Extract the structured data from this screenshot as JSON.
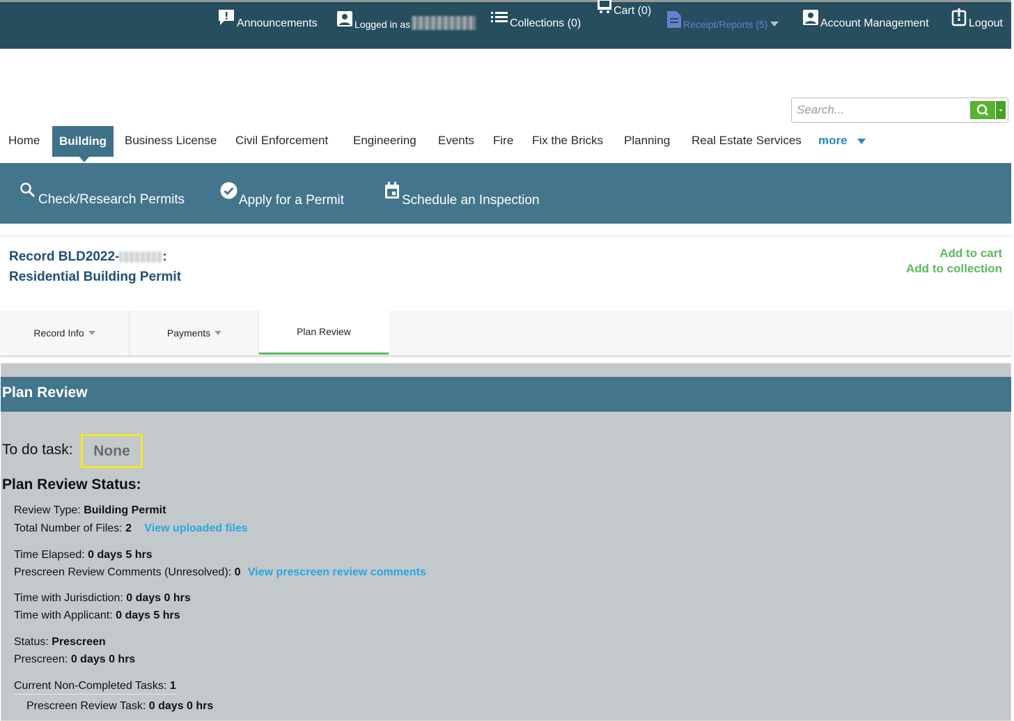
{
  "topbar": {
    "announcements": "Announcements",
    "logged_in": "Logged in as",
    "collections": "Collections (0)",
    "cart": "Cart (0)",
    "receipts": "Receipt/Reports (5)",
    "account": "Account Management",
    "logout": "Logout"
  },
  "search": {
    "placeholder": "Search..."
  },
  "nav": {
    "home": "Home",
    "building": "Building",
    "business_license": "Business License",
    "civil_enforcement": "Civil Enforcement",
    "engineering": "Engineering",
    "events": "Events",
    "fire": "Fire",
    "fix_the_bricks": "Fix the Bricks",
    "planning": "Planning",
    "real_estate": "Real Estate Services",
    "more": "more"
  },
  "subnav": {
    "check": "Check/Research Permits",
    "apply": "Apply for a Permit",
    "schedule": "Schedule an Inspection"
  },
  "record": {
    "prefix": "Record BLD2022-",
    "colon": ":",
    "type": "Residential Building Permit",
    "add_cart": "Add to cart",
    "add_collection": "Add to collection"
  },
  "tabs": {
    "record_info": "Record Info",
    "payments": "Payments",
    "plan_review": "Plan Review"
  },
  "plan_review": {
    "heading": "Plan Review",
    "todo_label": "To do task:",
    "todo_value": "None",
    "status_heading": "Plan Review Status:",
    "review_type_label": "Review Type:",
    "review_type_value": "Building Permit",
    "files_label": "Total Number of Files:",
    "files_value": "2",
    "files_link": "View uploaded files",
    "elapsed_label": "Time Elapsed:",
    "elapsed_value": "0 days 5 hrs",
    "prescreen_comments_label": "Prescreen Review Comments (Unresolved):",
    "prescreen_comments_value": "0",
    "prescreen_comments_link": "View prescreen review comments",
    "jurisdiction_label": "Time with Jurisdiction:",
    "jurisdiction_value": "0 days 0 hrs",
    "applicant_label": "Time with Applicant:",
    "applicant_value": "0 days 5 hrs",
    "status_label": "Status:",
    "status_value": "Prescreen",
    "prescreen_label": "Prescreen:",
    "prescreen_value": "0 days 0 hrs",
    "tasks_label": "Current Non-Completed Tasks:",
    "tasks_value": "1",
    "task_name_label": "Prescreen Review Task:",
    "task_name_value": "0 days 0 hrs"
  },
  "colors": {
    "topbar": "#264e5f",
    "nav_accent": "#43758c",
    "green": "#5cb85c",
    "link_blue": "#25a7e5",
    "highlight": "#f2e824"
  }
}
